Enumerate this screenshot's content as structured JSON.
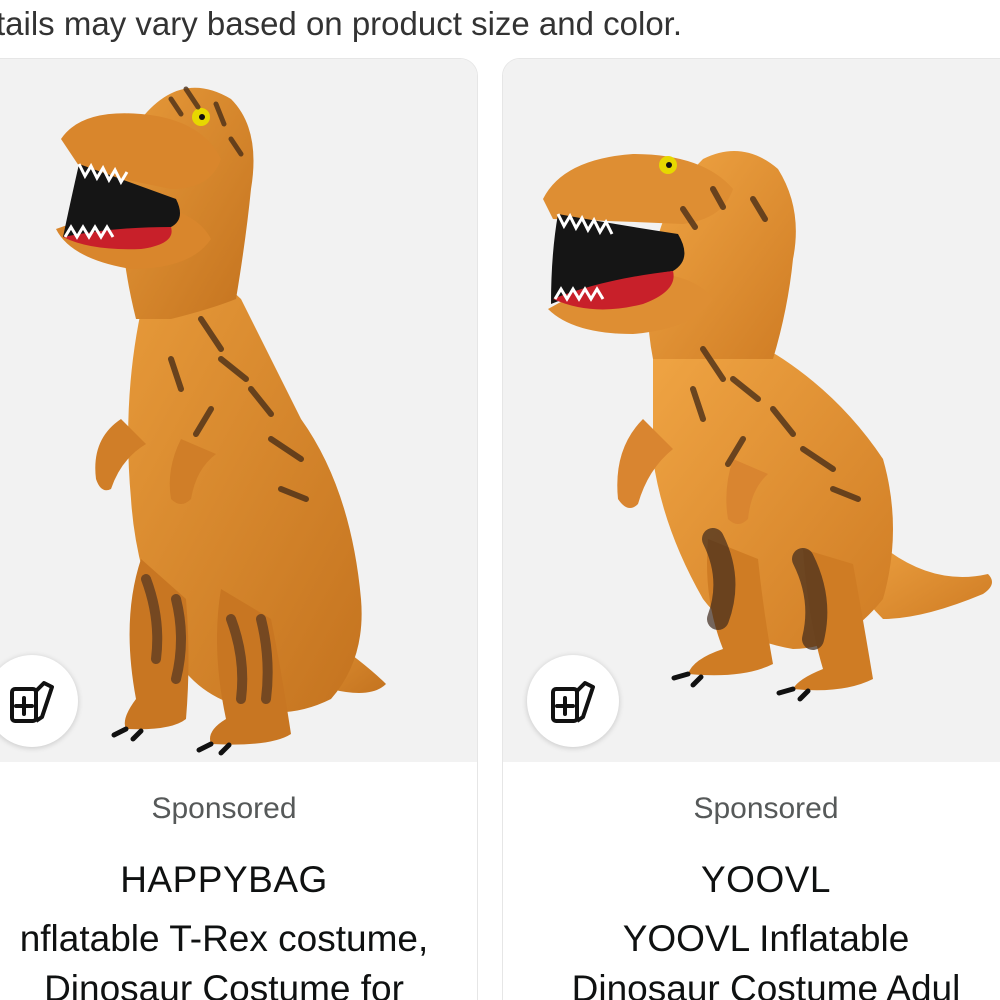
{
  "disclaimer": "tails may vary based on product size and color.",
  "products": [
    {
      "image_alt": "inflatable T-Rex costume",
      "sponsored": "Sponsored",
      "brand": "HAPPYBAG",
      "title_line1": "nflatable T-Rex costume,",
      "title_line2": "Dinosaur Costume for",
      "compare_icon": "add-to-compare-icon"
    },
    {
      "image_alt": "inflatable T-Rex costume",
      "sponsored": "Sponsored",
      "brand": "YOOVL",
      "title_line1": "YOOVL Inflatable",
      "title_line2": "Dinosaur Costume Adul",
      "compare_icon": "add-to-compare-icon"
    }
  ],
  "colors": {
    "costume_orange": "#d98a2b",
    "costume_dark": "#5a3a22",
    "mouth_red": "#c8202a",
    "image_bg": "#f2f2f2",
    "sponsored_gray": "#565959"
  }
}
